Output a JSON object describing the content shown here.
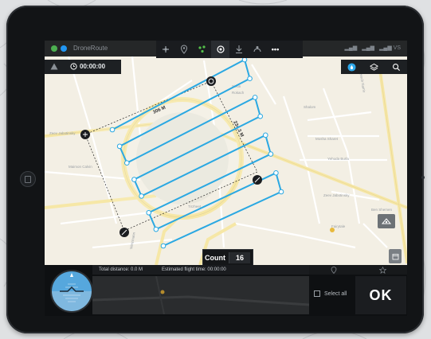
{
  "app": {
    "name": "DroneRoute"
  },
  "topbar": {
    "status_dots": [
      "#4caf50",
      "#2196f3"
    ],
    "tools": [
      {
        "icon": "drone-icon"
      },
      {
        "icon": "location-pin-icon"
      },
      {
        "icon": "waypoint-cluster-icon",
        "color": "#54c04a"
      },
      {
        "icon": "target-scan-icon",
        "active": true
      },
      {
        "icon": "landing-icon"
      },
      {
        "icon": "orbit-icon"
      },
      {
        "icon": "more-icon",
        "label": "•••"
      }
    ],
    "signals": [
      "▂▄▆",
      "▂▄▆",
      "▂▄▆ VS"
    ]
  },
  "timer": {
    "warning_icon": "warning-icon",
    "time": "00:00:00"
  },
  "map_tools": [
    {
      "icon": "water-drop-icon",
      "color": "#2ca7ea"
    },
    {
      "icon": "layers-icon"
    },
    {
      "icon": "search-icon"
    }
  ],
  "survey": {
    "width_label": "306 M",
    "height_label": "234.3 M",
    "line_color": "#2aa8e2",
    "waypoint_count": 16
  },
  "count": {
    "label": "Count",
    "value": "16"
  },
  "bottom": {
    "total_distance": "Total distance: 0.0 M",
    "flight_time": "Estimated flight time: 00:00:00",
    "select_all": "Select all",
    "ok": "OK"
  },
  "colors": {
    "map_bg": "#f3efe4",
    "road": "#f6e7a6",
    "accent": "#2aa8e2"
  }
}
